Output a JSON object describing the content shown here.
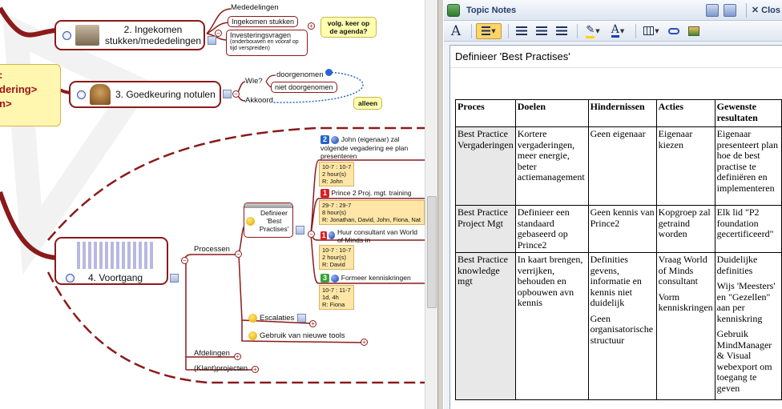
{
  "mindmap": {
    "central_lines": [
      ":",
      "dering>",
      "n>"
    ],
    "topics": {
      "t2": "2. Ingekomen stukken/mededelingen",
      "t3": "3. Goedkeuring notulen",
      "t4": "4. Voortgang"
    },
    "t2_children": [
      "Mededelingen",
      "Ingekomen stukken",
      "Investeringsvragen",
      "(onderbouwen en vooraf op tijd verspreiden)"
    ],
    "t2_callout": "volg. keer op de agenda?",
    "t3_children": {
      "wie": "Wie?",
      "akkoord": "Akkoord",
      "doorgenomen": "doorgenomen",
      "niet_doorgenomen": "niet doorgenomen"
    },
    "t3_callout": "alleen",
    "t4_children": {
      "processen": "Processen",
      "afdelingen": "Afdelingen",
      "klantprojecten": "(Klant)projecten"
    },
    "processen_children": {
      "best_practises": "Definieer 'Best Practises'",
      "escalaties": "Escalaties",
      "tools": "Gebruik van nieuwe tools"
    },
    "tasks": [
      {
        "num": "2",
        "num_color": "#2b62c8",
        "title": "John (eigenaar) zal volgende vegadering ee plan presenteren",
        "info": [
          "10-7 : 10-7",
          "2 hour(s)",
          "R: John"
        ]
      },
      {
        "num": "1",
        "num_color": "#d42020",
        "title": "Prince 2 Proj. mgt. training",
        "info": [
          "29-7 : 29-7",
          "8 hour(s)",
          "R: Jonathan, David, John, Fiona, Nat"
        ]
      },
      {
        "num": "1",
        "num_color": "#d42020",
        "title": "Huur consultant van World of Minds in",
        "info": [
          "10-7 : 10-7",
          "2 hour(s)",
          "R: David"
        ]
      },
      {
        "num": "3",
        "num_color": "#3aa23a",
        "title": "Formeer kenniskringen",
        "info": [
          "10-7 : 11-7",
          "1d, 4h",
          "R: Fiona"
        ]
      }
    ]
  },
  "notes_panel": {
    "title": "Topic Notes",
    "close_label": "Clos",
    "heading": "Definieer 'Best Practises'",
    "table": {
      "headers": [
        "Proces",
        "Doelen",
        "Hindernissen",
        "Acties",
        "Gewenste resultaten"
      ],
      "rows": [
        {
          "proces": "Best Practice Vergaderingen",
          "doelen": [
            "Kortere vergaderingen, meer energie, beter actiemanagement"
          ],
          "hindernissen": [
            "Geen eigenaar"
          ],
          "acties": [
            "Eigenaar kiezen"
          ],
          "resultaten": [
            "Eigenaar presenteert plan hoe de best practise te definiëren en implementeren"
          ]
        },
        {
          "proces": "Best Practice Project Mgt",
          "doelen": [
            "Definieer een standaard gebaseerd op Prince2"
          ],
          "hindernissen": [
            "Geen kennis van Prince2"
          ],
          "acties": [
            "Kopgroep zal getraind worden"
          ],
          "resultaten": [
            "Elk lid \"P2 foundation gecertificeerd\""
          ]
        },
        {
          "proces": "Best Practice knowledge mgt",
          "doelen": [
            "In kaart brengen, verrijken, behouden en opbouwen avn kennis"
          ],
          "hindernissen": [
            "Definities gevens, informatie en kennis niet duidelijk",
            "Geen organisatorische structuur"
          ],
          "acties": [
            "Vraag World of Minds consultant",
            "Vorm kenniskringen"
          ],
          "resultaten": [
            "Duidelijke definities",
            "Wijs 'Meesters' en \"Gezellen\" aan per kenniskring",
            "Gebruik MindManager & Visual webexport om toegang te geven"
          ]
        }
      ]
    }
  }
}
